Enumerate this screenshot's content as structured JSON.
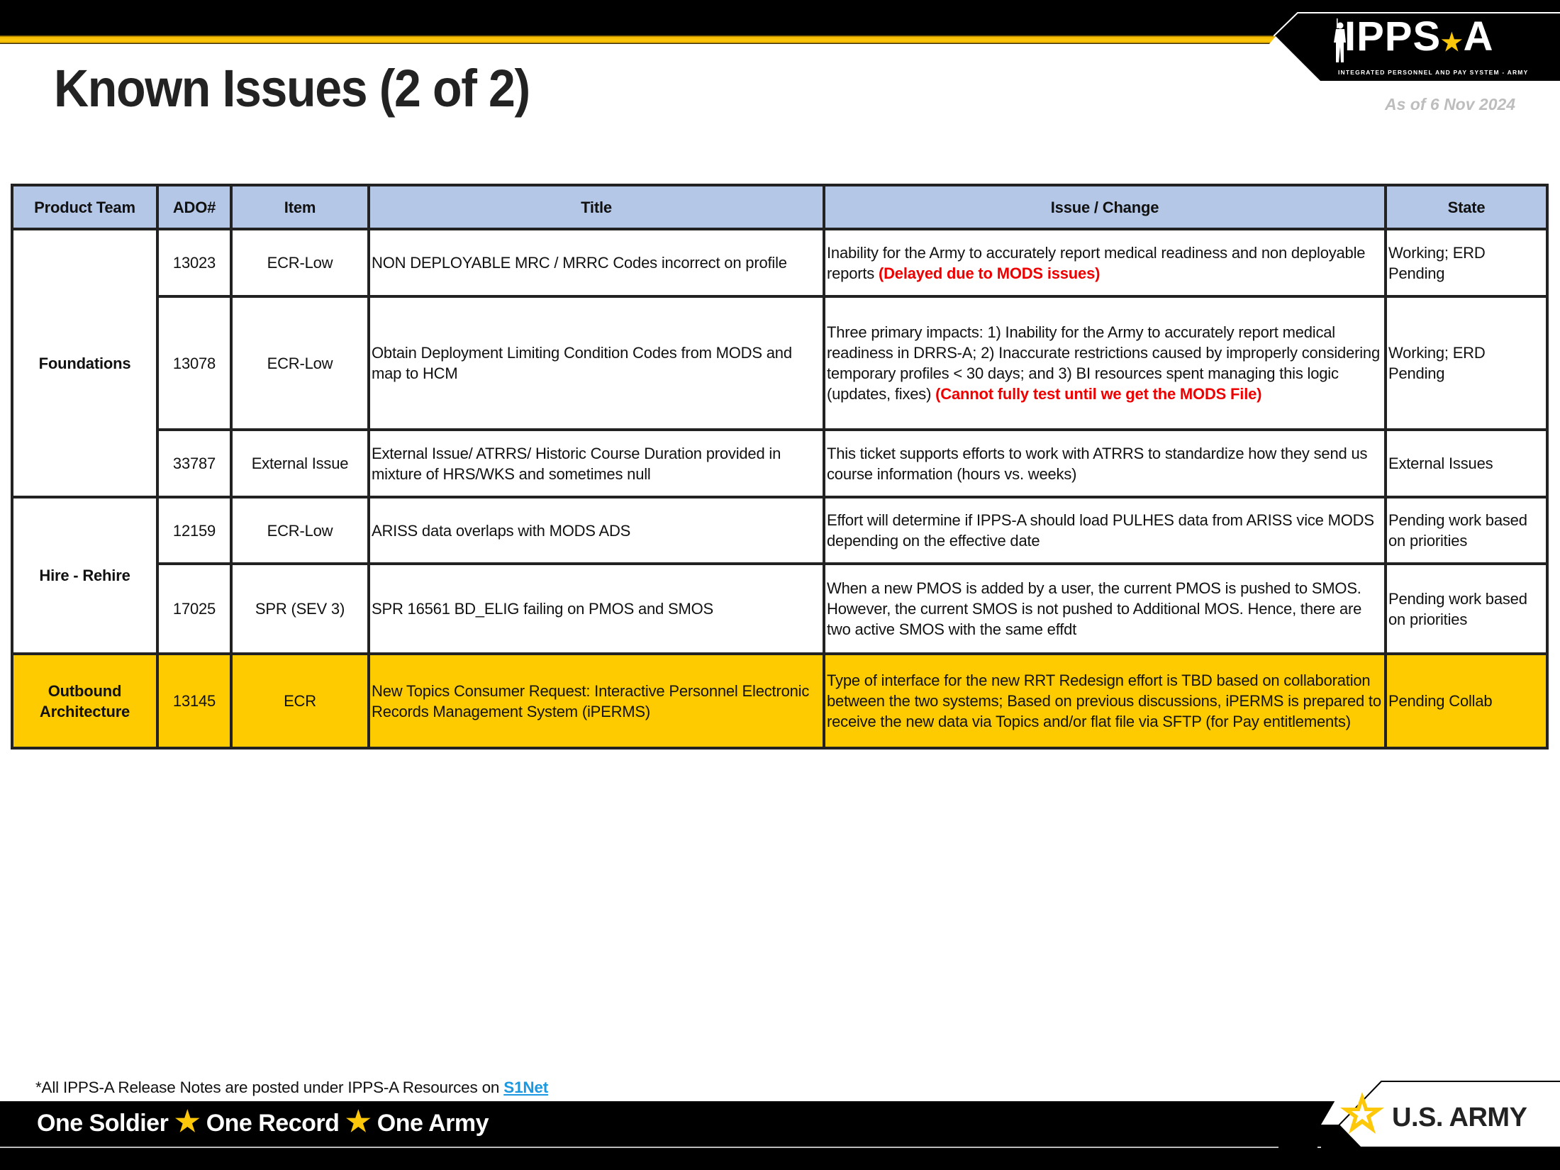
{
  "header": {
    "title": "Known Issues (2 of 2)",
    "as_of": "As of 6 Nov 2024",
    "logo": {
      "text_main": "IPPS",
      "text_end": "A",
      "subtitle": "INTEGRATED PERSONNEL AND PAY SYSTEM - ARMY"
    }
  },
  "table": {
    "columns": [
      "Product Team",
      "ADO#",
      "Item",
      "Title",
      "Issue / Change",
      "State"
    ],
    "groups": [
      {
        "team": "Foundations"
      },
      {
        "team": "Hire - Rehire"
      },
      {
        "team": "Outbound Architecture"
      }
    ],
    "rows": [
      {
        "team": "Foundations",
        "ado": "13023",
        "item": "ECR-Low",
        "title": "NON DEPLOYABLE MRC / MRRC  Codes incorrect on profile",
        "issue": "Inability for the Army to accurately report medical readiness and non deployable reports ",
        "issue_note": "(Delayed due to MODS issues)",
        "state": "Working; ERD Pending"
      },
      {
        "team": "Foundations",
        "ado": "13078",
        "item": "ECR-Low",
        "title": "Obtain Deployment Limiting Condition Codes from MODS and map to HCM",
        "issue": "Three primary impacts: 1) Inability for the Army to accurately report medical readiness in DRRS-A; 2) Inaccurate restrictions caused by improperly considering temporary profiles < 30 days; and 3) BI resources spent managing this logic (updates, fixes) ",
        "issue_note": "(Cannot fully test until we get the MODS File)",
        "state": "Working; ERD Pending"
      },
      {
        "team": "Foundations",
        "ado": "33787",
        "item": "External Issue",
        "title": "External Issue/ ATRRS/ Historic Course Duration provided in mixture of HRS/WKS and sometimes null",
        "issue": "This ticket supports efforts to work with ATRRS to standardize how they send us course information (hours vs. weeks)",
        "issue_note": "",
        "state": "External Issues"
      },
      {
        "team": "Hire - Rehire",
        "ado": "12159",
        "item": "ECR-Low",
        "title": "ARISS data overlaps with MODS ADS",
        "issue": "Effort will determine if IPPS-A should load PULHES data from ARISS vice MODS depending on the effective date",
        "issue_note": "",
        "state": "Pending work based on priorities"
      },
      {
        "team": "Hire - Rehire",
        "ado": "17025",
        "item": "SPR (SEV 3)",
        "title": "SPR 16561 BD_ELIG failing on PMOS and SMOS",
        "issue": "When a new PMOS is added by a user, the current PMOS is pushed to SMOS.  However, the current SMOS is not pushed to Additional MOS.  Hence, there are two active SMOS with the same effdt",
        "issue_note": "",
        "state": "Pending work based on priorities"
      },
      {
        "team": "Outbound Architecture",
        "ado": "13145",
        "item": "ECR",
        "title": "New Topics Consumer Request: Interactive Personnel Electronic Records Management System (iPERMS)",
        "issue": "Type of interface for the new RRT Redesign effort is TBD based on collaboration between the two systems; Based on previous discussions, iPERMS is prepared to receive the new data via Topics and/or flat file via SFTP (for Pay entitlements)",
        "issue_note": "",
        "state": "Pending Collab",
        "highlighted": true
      }
    ]
  },
  "footer": {
    "note": "*All IPPS-A Release Notes are posted under IPPS-A Resources on ",
    "link_label": "S1Net",
    "tagline": [
      "One Soldier",
      "One Record",
      "One Army"
    ],
    "tagline_separator_icon": "star-icon",
    "army_logo_text": "U.S. ARMY"
  },
  "colors": {
    "gold": "#fec80a",
    "header_blue": "#b4c7e7",
    "highlight_yellow": "#fecb00",
    "alert_red": "#ee0000",
    "link_blue": "#1b98e0"
  }
}
